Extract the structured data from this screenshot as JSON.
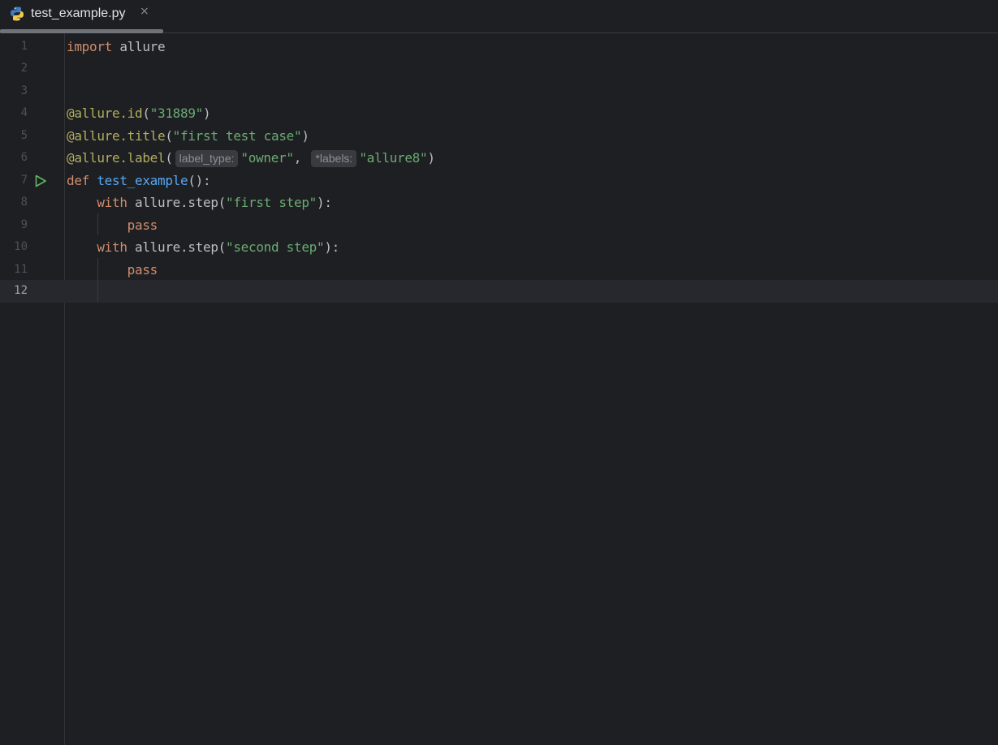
{
  "tab": {
    "title": "test_example.py",
    "close": "×",
    "icon": "python-icon"
  },
  "editor": {
    "current_line": 12,
    "lines": [
      {
        "n": "1"
      },
      {
        "n": "2"
      },
      {
        "n": "3"
      },
      {
        "n": "4"
      },
      {
        "n": "5"
      },
      {
        "n": "6"
      },
      {
        "n": "7"
      },
      {
        "n": "8"
      },
      {
        "n": "9"
      },
      {
        "n": "10"
      },
      {
        "n": "11"
      },
      {
        "n": "12"
      }
    ],
    "code": {
      "l1_kw": "import",
      "l1_rest": " allure",
      "l4_dec": "@allure.id",
      "l4_open": "(",
      "l4_str": "\"31889\"",
      "l4_close": ")",
      "l5_dec": "@allure.title",
      "l5_open": "(",
      "l5_str": "\"first test case\"",
      "l5_close": ")",
      "l6_dec": "@allure.label",
      "l6_open": "(",
      "l6_hint1": "label_type:",
      "l6_str1": "\"owner\"",
      "l6_comma": ", ",
      "l6_hint2": "*labels:",
      "l6_str2": "\"allure8\"",
      "l6_close": ")",
      "l7_kw": "def",
      "l7_sp": " ",
      "l7_fn": "test_example",
      "l7_rest": "():",
      "l8_indent": "    ",
      "l8_kw": "with",
      "l8_mid": " allure.step(",
      "l8_str": "\"first step\"",
      "l8_close": "):",
      "l9_indent": "        ",
      "l9_kw": "pass",
      "l10_indent": "    ",
      "l10_kw": "with",
      "l10_mid": " allure.step(",
      "l10_str": "\"second step\"",
      "l10_close": "):",
      "l11_indent": "        ",
      "l11_kw": "pass"
    }
  },
  "colors": {
    "background": "#1e1f22",
    "keyword": "#cf8e6d",
    "decorator": "#b3ae60",
    "string": "#6aab73",
    "function": "#56a8f5",
    "run_icon": "#5fb865"
  }
}
